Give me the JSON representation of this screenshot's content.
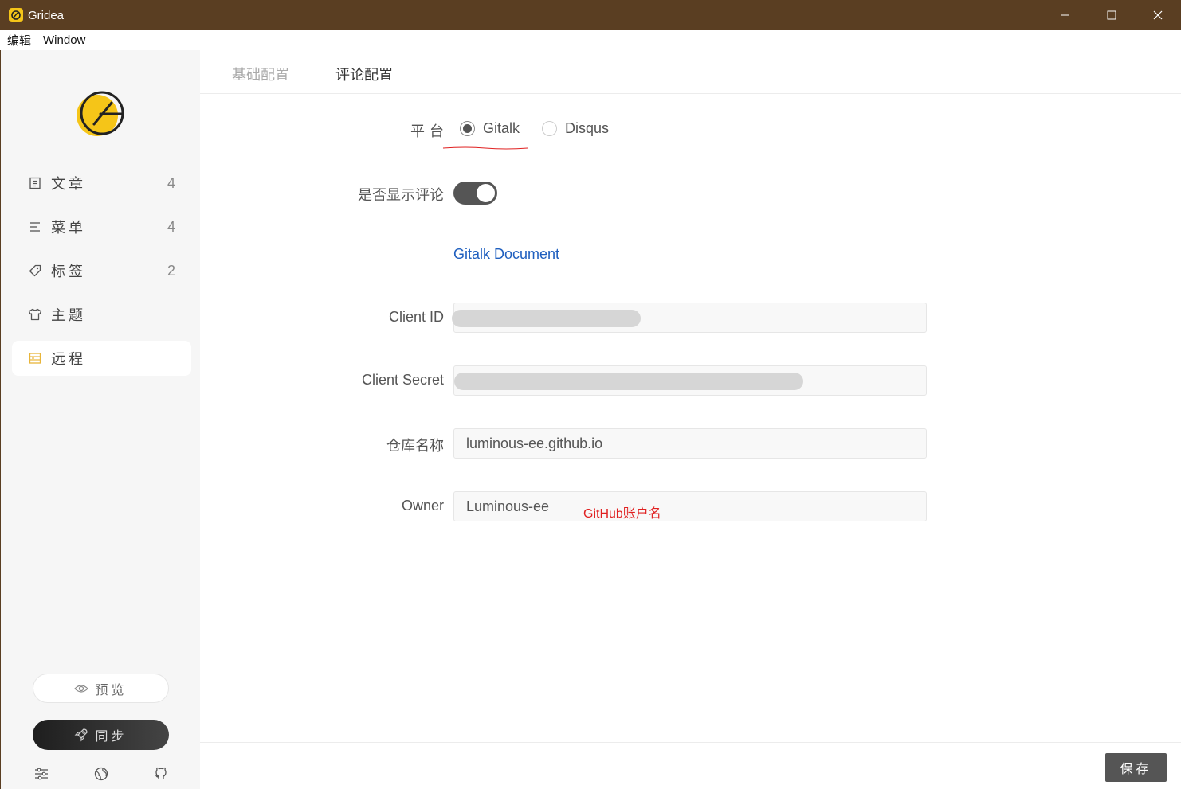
{
  "window": {
    "title": "Gridea"
  },
  "menu": {
    "items": [
      "编辑",
      "Window"
    ]
  },
  "sidebar": {
    "items": [
      {
        "label": "文章",
        "count": "4",
        "icon": "article-icon"
      },
      {
        "label": "菜单",
        "count": "4",
        "icon": "menu-icon"
      },
      {
        "label": "标签",
        "count": "2",
        "icon": "tag-icon"
      },
      {
        "label": "主题",
        "count": "",
        "icon": "shirt-icon"
      },
      {
        "label": "远程",
        "count": "",
        "icon": "server-icon",
        "active": true
      }
    ],
    "preview_label": "预览",
    "sync_label": "同步"
  },
  "tabs": [
    {
      "label": "基础配置",
      "active": false
    },
    {
      "label": "评论配置",
      "active": true
    }
  ],
  "form": {
    "platform_label": "平台",
    "platform_options": [
      "Gitalk",
      "Disqus"
    ],
    "platform_selected": "Gitalk",
    "show_comment_label": "是否显示评论",
    "show_comment_on": true,
    "doc_link": "Gitalk Document",
    "client_id_label": "Client ID",
    "client_secret_label": "Client Secret",
    "repo_label": "仓库名称",
    "repo_value": "luminous-ee.github.io",
    "owner_label": "Owner",
    "owner_value": "Luminous-ee"
  },
  "annotation": "GitHub账户名",
  "footer": {
    "save_label": "保存"
  },
  "colors": {
    "titlebar": "#5a3e22",
    "accent": "#f5c518",
    "link": "#1f5fbf",
    "annotation": "#e02020"
  }
}
